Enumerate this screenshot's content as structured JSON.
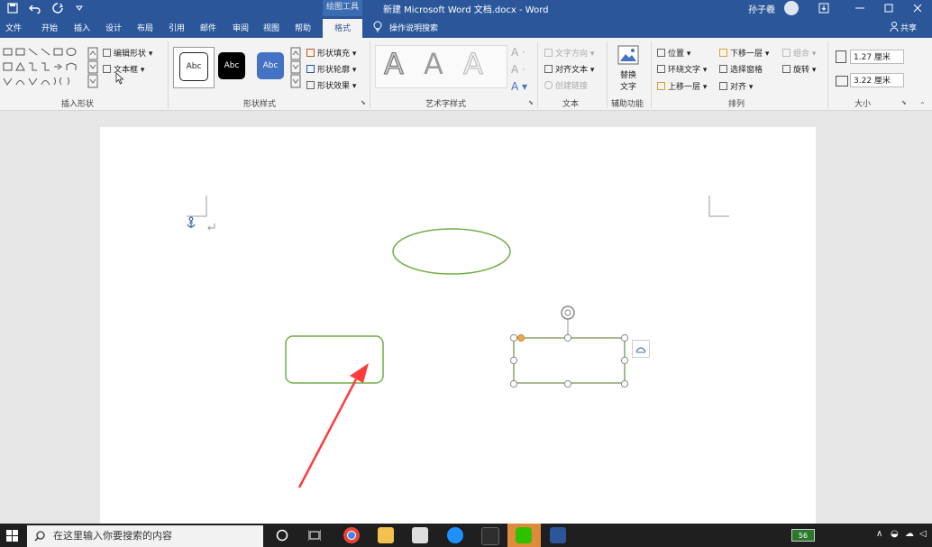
{
  "titlebar": {
    "quick_access": [
      "save-icon",
      "undo-icon",
      "redo-icon",
      "customize-icon"
    ],
    "context_group": "绘图工具",
    "document_title": "新建 Microsoft Word 文档.docx - Word",
    "user_name": "孙子羲",
    "window_controls": [
      "ribbon-display-icon",
      "minimize-icon",
      "restore-icon",
      "close-icon"
    ]
  },
  "tabs": {
    "file": "文件",
    "home": "开始",
    "insert": "插入",
    "design": "设计",
    "layout": "布局",
    "references": "引用",
    "mailings": "邮件",
    "review": "审阅",
    "view": "视图",
    "help": "帮助",
    "format": "格式",
    "tell_me": "操作说明搜索",
    "share": "共享"
  },
  "ribbon": {
    "insert_shapes": {
      "label": "插入形状",
      "edit_shape": "编辑形状",
      "text_box": "文本框"
    },
    "shape_styles": {
      "label": "形状样式",
      "swatches": [
        "Abc",
        "Abc",
        "Abc"
      ],
      "fill": "形状填充",
      "outline": "形状轮廓",
      "effects": "形状效果"
    },
    "wordart_styles": {
      "label": "艺术字样式",
      "letters": [
        "A",
        "A",
        "A"
      ]
    },
    "text": {
      "label": "文本",
      "direction": "文字方向",
      "align": "对齐文本",
      "link": "创建链接"
    },
    "accessibility": {
      "label": "辅助功能",
      "alt_text_line1": "替换",
      "alt_text_line2": "文字"
    },
    "arrange": {
      "label": "排列",
      "position": "位置",
      "wrap_text": "环绕文字",
      "bring_forward": "上移一层",
      "send_backward": "下移一层",
      "selection_pane": "选择窗格",
      "align": "对齐",
      "group": "组合",
      "rotate": "旋转"
    },
    "size": {
      "label": "大小",
      "height": "1.27 厘米",
      "width": "3.22 厘米"
    }
  },
  "taskbar": {
    "search_placeholder": "在这里输入你要搜索的内容",
    "battery": "56",
    "clock_time": "",
    "clock_date": ""
  },
  "colors": {
    "title_blue": "#2b579a",
    "shape_green": "#70ad47",
    "arrow_red": "#ff3b3b",
    "handle_orange": "#e8a84c"
  }
}
